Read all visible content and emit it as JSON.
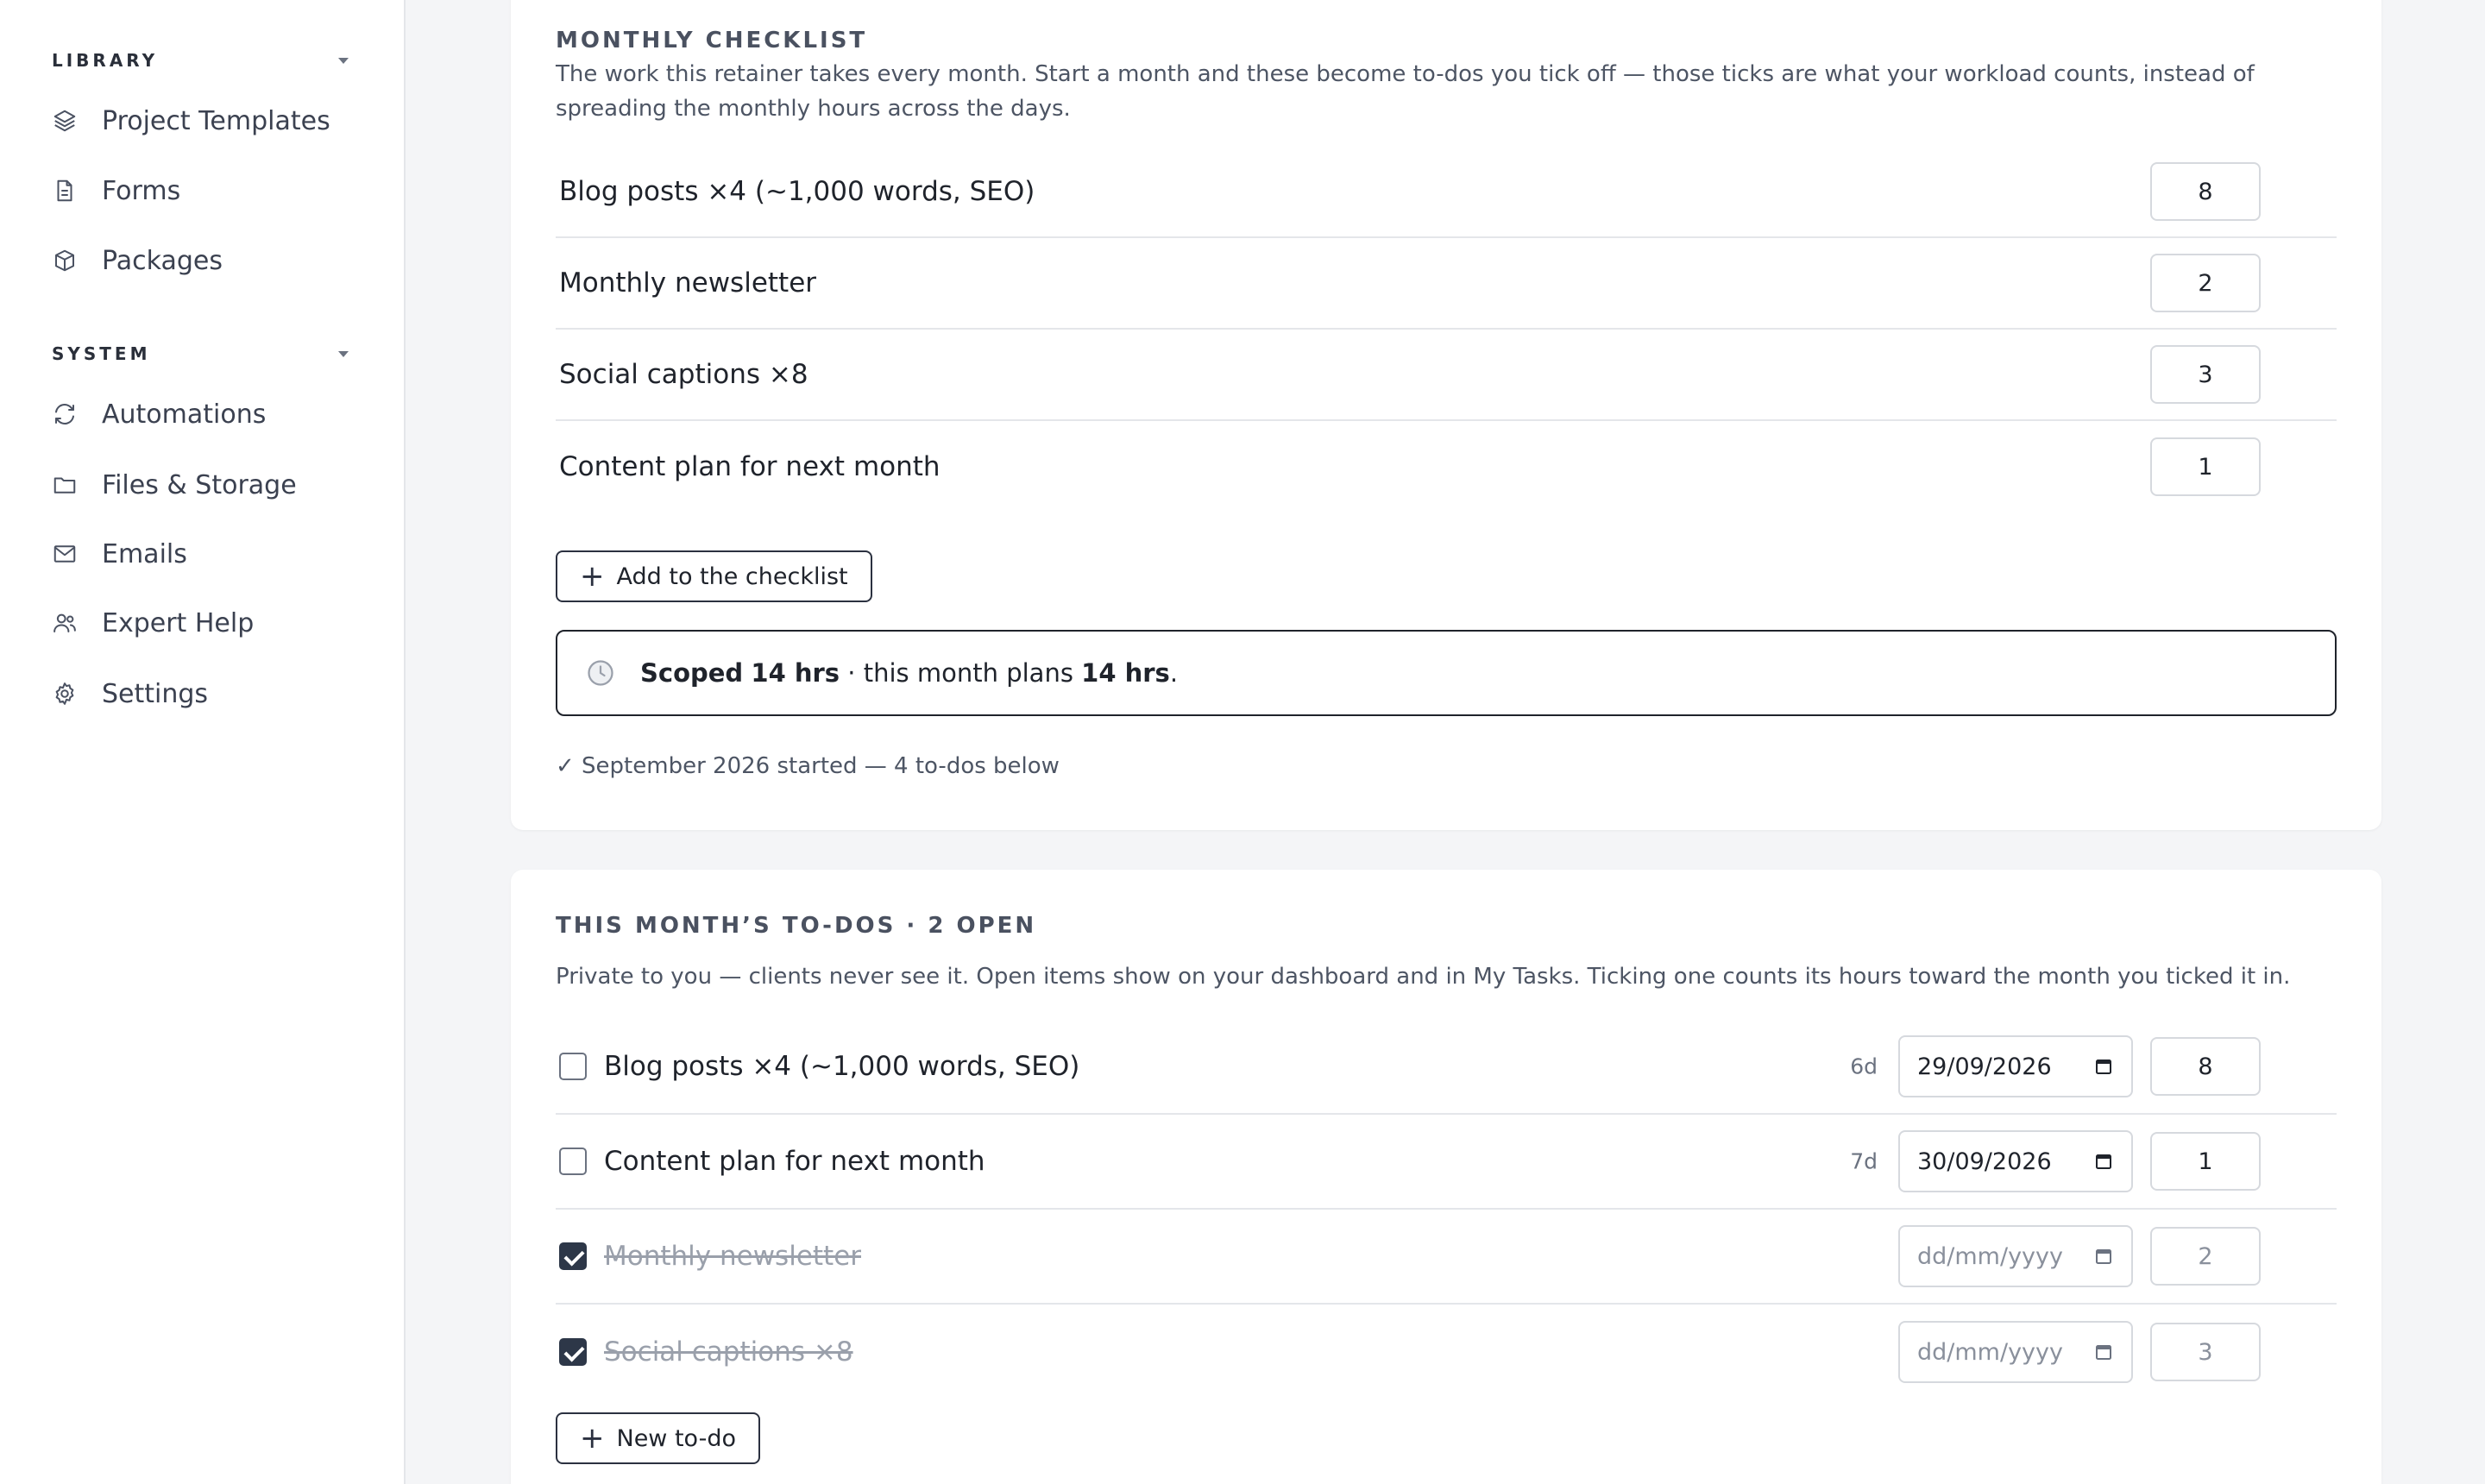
{
  "sidebar": {
    "library_heading": "LIBRARY",
    "library_items": [
      {
        "label": "Project Templates",
        "icon": "layers-icon"
      },
      {
        "label": "Forms",
        "icon": "document-icon"
      },
      {
        "label": "Packages",
        "icon": "package-icon"
      }
    ],
    "system_heading": "SYSTEM",
    "system_items": [
      {
        "label": "Automations",
        "icon": "refresh-icon"
      },
      {
        "label": "Files & Storage",
        "icon": "folder-icon"
      },
      {
        "label": "Emails",
        "icon": "mail-icon"
      },
      {
        "label": "Expert Help",
        "icon": "users-icon"
      },
      {
        "label": "Settings",
        "icon": "gear-icon"
      }
    ]
  },
  "checklist": {
    "title": "MONTHLY CHECKLIST",
    "description": "The work this retainer takes every month. Start a month and these become to-dos you tick off — those ticks are what your workload counts, instead of spreading the monthly hours across the days.",
    "items": [
      {
        "label": "Blog posts ×4 (~1,000 words, SEO)",
        "hours": "8"
      },
      {
        "label": "Monthly newsletter",
        "hours": "2"
      },
      {
        "label": "Social captions ×8",
        "hours": "3"
      },
      {
        "label": "Content plan for next month",
        "hours": "1"
      }
    ],
    "add_button": "Add to the checklist",
    "summary": {
      "scoped_label": "Scoped",
      "scoped_value": "14 hrs",
      "middle": " · this month plans ",
      "plans_value": "14 hrs",
      "end": "."
    },
    "status": "✓ September 2026 started — 4 to-dos below"
  },
  "todos": {
    "title": "THIS MONTH’S TO-DOS · 2 OPEN",
    "description": "Private to you — clients never see it. Open items show on your dashboard and in My Tasks. Ticking one counts its hours toward the month you ticked it in.",
    "items": [
      {
        "label": "Blog posts ×4 (~1,000 words, SEO)",
        "done": false,
        "days": "6d",
        "date": "29/09/2026",
        "hours": "8"
      },
      {
        "label": "Content plan for next month",
        "done": false,
        "days": "7d",
        "date": "30/09/2026",
        "hours": "1"
      },
      {
        "label": "Monthly newsletter",
        "done": true,
        "days": "",
        "date": "",
        "hours": "2"
      },
      {
        "label": "Social captions ×8",
        "done": true,
        "days": "",
        "date": "",
        "hours": "3"
      }
    ],
    "date_placeholder": "dd/mm/yyyy",
    "new_button": "New to-do"
  }
}
